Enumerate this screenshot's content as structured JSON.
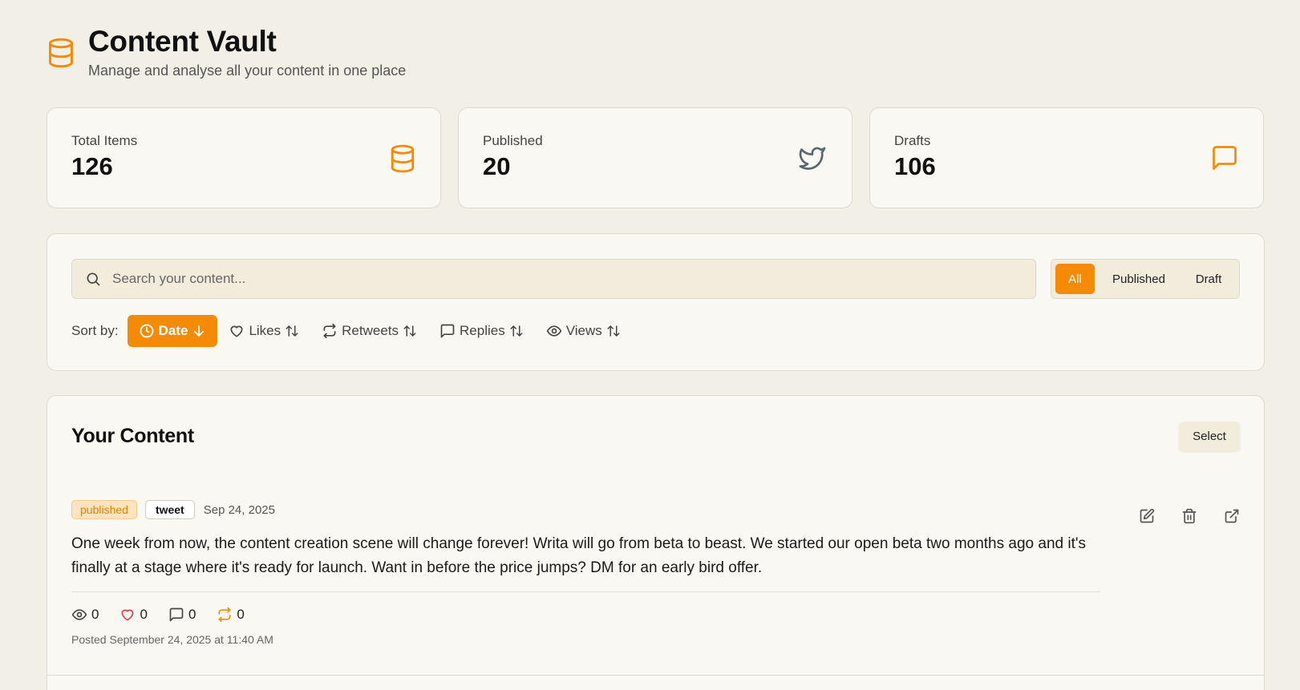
{
  "header": {
    "title": "Content Vault",
    "subtitle": "Manage and analyse all your content in one place",
    "logo_icon": "database-icon"
  },
  "stats": [
    {
      "label": "Total Items",
      "value": "126",
      "icon": "database-icon",
      "icon_color": "#f58a07"
    },
    {
      "label": "Published",
      "value": "20",
      "icon": "twitter-icon",
      "icon_color": "#5b6770"
    },
    {
      "label": "Drafts",
      "value": "106",
      "icon": "message-square-icon",
      "icon_color": "#f58a07"
    }
  ],
  "search": {
    "placeholder": "Search your content...",
    "value": ""
  },
  "status_filter": {
    "options": [
      "All",
      "Published",
      "Draft"
    ],
    "selected": "All"
  },
  "sort": {
    "label": "Sort by:",
    "options": [
      {
        "label": "Date",
        "icon": "clock-icon",
        "direction": "down",
        "active": true
      },
      {
        "label": "Likes",
        "icon": "heart-icon",
        "direction": "both",
        "active": false
      },
      {
        "label": "Retweets",
        "icon": "repeat-icon",
        "direction": "both",
        "active": false
      },
      {
        "label": "Replies",
        "icon": "message-square-icon",
        "direction": "both",
        "active": false
      },
      {
        "label": "Views",
        "icon": "eye-icon",
        "direction": "both",
        "active": false
      }
    ]
  },
  "content": {
    "title": "Your Content",
    "select_label": "Select",
    "posts": [
      {
        "status": "published",
        "type": "tweet",
        "date": "Sep 24, 2025",
        "text": "One week from now, the content creation scene will change forever! Writa will go from beta to beast. We started our open beta two months ago and it's finally at a stage where it's ready for launch. Want in before the price jumps? DM for an early bird offer.",
        "views": "0",
        "likes": "0",
        "replies": "0",
        "retweets": "0",
        "posted": "Posted September 24, 2025 at 11:40 AM"
      }
    ]
  },
  "colors": {
    "accent": "#f58a07",
    "background": "#f1efe6",
    "card": "#faf8f2",
    "like_red": "#e0403a"
  }
}
